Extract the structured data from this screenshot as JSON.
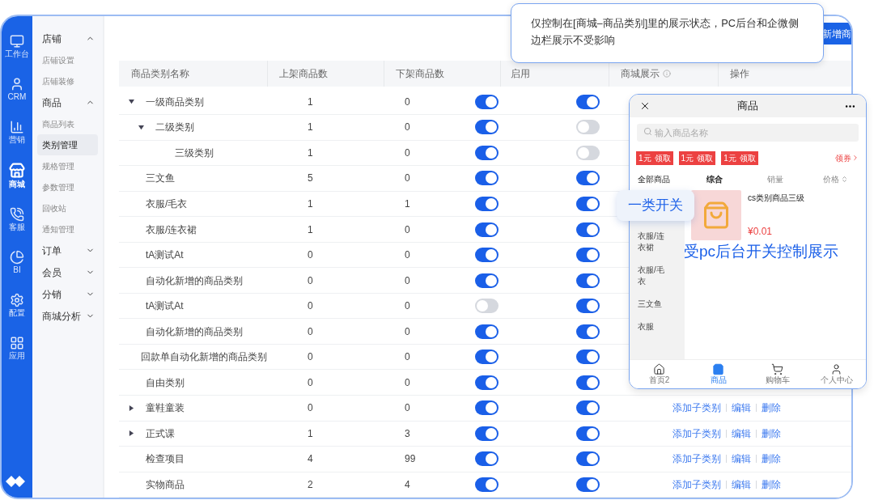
{
  "rail": {
    "items": [
      {
        "label": "工作台",
        "selected": false
      },
      {
        "label": "CRM",
        "selected": false
      },
      {
        "label": "营销",
        "selected": false
      },
      {
        "label": "商城",
        "selected": true
      },
      {
        "label": "客服",
        "selected": false
      },
      {
        "label": "BI",
        "selected": false
      },
      {
        "label": "配置",
        "selected": false
      },
      {
        "label": "应用",
        "selected": false
      }
    ]
  },
  "sidebar": {
    "groups": [
      {
        "label": "店铺",
        "expanded": true,
        "items": [
          {
            "label": "店铺设置",
            "selected": false
          },
          {
            "label": "店铺装修",
            "selected": false
          }
        ]
      },
      {
        "label": "商品",
        "expanded": true,
        "items": [
          {
            "label": "商品列表",
            "selected": false
          },
          {
            "label": "类别管理",
            "selected": true
          },
          {
            "label": "规格管理",
            "selected": false
          },
          {
            "label": "参数管理",
            "selected": false
          },
          {
            "label": "回收站",
            "selected": false
          },
          {
            "label": "通知管理",
            "selected": false
          }
        ]
      },
      {
        "label": "订单",
        "expanded": false
      },
      {
        "label": "会员",
        "expanded": false
      },
      {
        "label": "分销",
        "expanded": false
      },
      {
        "label": "商城分析",
        "expanded": false
      }
    ]
  },
  "add_button": {
    "label": "新增商"
  },
  "table": {
    "columns": [
      "商品类别名称",
      "上架商品数",
      "下架商品数",
      "启用",
      "商城展示",
      "操作"
    ],
    "rows": [
      {
        "name": "一级商品类别",
        "on_shelf": "1",
        "off_shelf": "0",
        "enabled": true,
        "mall_display": true,
        "expanded": true,
        "children": [
          {
            "name": "二级类别",
            "on_shelf": "1",
            "off_shelf": "0",
            "enabled": true,
            "mall_display": false,
            "expanded": true,
            "children": [
              {
                "name": "三级类别",
                "on_shelf": "1",
                "off_shelf": "0",
                "enabled": true,
                "mall_display": false
              }
            ]
          }
        ]
      },
      {
        "name": "三文鱼",
        "on_shelf": "5",
        "off_shelf": "0",
        "enabled": true,
        "mall_display": true
      },
      {
        "name": "衣服/毛衣",
        "on_shelf": "1",
        "off_shelf": "1",
        "enabled": true,
        "mall_display": true
      },
      {
        "name": "衣服/连衣裙",
        "on_shelf": "1",
        "off_shelf": "0",
        "enabled": true,
        "mall_display": true
      },
      {
        "name": "tA测试At",
        "on_shelf": "0",
        "off_shelf": "0",
        "enabled": true,
        "mall_display": true
      },
      {
        "name": "自动化新增的商品类别",
        "on_shelf": "0",
        "off_shelf": "0",
        "enabled": true,
        "mall_display": true
      },
      {
        "name": "tA测试At",
        "on_shelf": "0",
        "off_shelf": "0",
        "enabled": false,
        "mall_display": true
      },
      {
        "name": "自动化新增的商品类别",
        "on_shelf": "0",
        "off_shelf": "0",
        "enabled": true,
        "mall_display": true
      },
      {
        "name": "回款单自动化新增的商品类别",
        "on_shelf": "0",
        "off_shelf": "0",
        "enabled": true,
        "mall_display": true
      },
      {
        "name": "自由类别",
        "on_shelf": "0",
        "off_shelf": "0",
        "enabled": true,
        "mall_display": true
      },
      {
        "name": "童鞋童装",
        "on_shelf": "0",
        "off_shelf": "0",
        "enabled": true,
        "mall_display": true,
        "expanded": false,
        "actions": [
          "添加子类别",
          "编辑",
          "删除"
        ]
      },
      {
        "name": "正式课",
        "on_shelf": "1",
        "off_shelf": "3",
        "enabled": true,
        "mall_display": true,
        "expanded": false,
        "actions": [
          "添加子类别",
          "编辑",
          "删除"
        ]
      },
      {
        "name": "检查项目",
        "on_shelf": "4",
        "off_shelf": "99",
        "enabled": true,
        "mall_display": true,
        "actions": [
          "添加子类别",
          "编辑",
          "删除"
        ]
      },
      {
        "name": "实物商品",
        "on_shelf": "2",
        "off_shelf": "4",
        "enabled": true,
        "mall_display": true,
        "actions": [
          "添加子类别",
          "编辑",
          "删除"
        ]
      }
    ]
  },
  "tooltip": {
    "text": "仅控制在[商城–商品类别]里的展示状态，PC后台和企微侧边栏展示不受影响"
  },
  "phone": {
    "title": "商品",
    "search": {
      "placeholder": "输入商品名称"
    },
    "coupons": [
      {
        "amount": "1元",
        "action": "领取"
      },
      {
        "amount": "1元",
        "action": "领取"
      },
      {
        "amount": "1元",
        "action": "领取"
      }
    ],
    "coupon_link": "领券",
    "categories": [
      {
        "label": "全部商品",
        "selected": true
      },
      {
        "label": "衣服/连衣裙",
        "selected": false
      },
      {
        "label": "衣服/毛衣",
        "selected": false
      },
      {
        "label": "三文鱼",
        "selected": false
      },
      {
        "label": "衣服",
        "selected": false
      }
    ],
    "sort_tabs": [
      {
        "label": "综合",
        "selected": true
      },
      {
        "label": "销量",
        "selected": false
      },
      {
        "label": "价格",
        "selected": false
      }
    ],
    "product": {
      "name": "cs类别商品三级",
      "price": "¥0.01"
    },
    "nav": [
      {
        "label": "首页2",
        "selected": false
      },
      {
        "label": "商品",
        "selected": true
      },
      {
        "label": "购物车",
        "selected": false
      },
      {
        "label": "个人中心",
        "selected": false
      }
    ]
  },
  "callout": {
    "text": "一类开关"
  },
  "annotation": {
    "text": "受pc后台开关控制展示"
  }
}
